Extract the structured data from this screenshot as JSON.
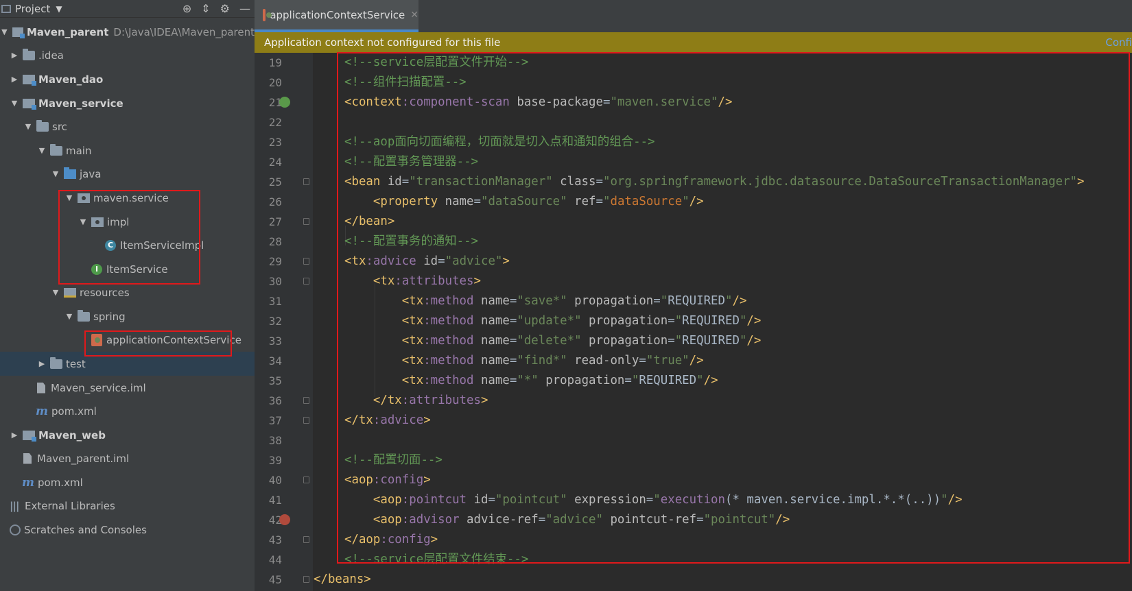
{
  "project_panel": {
    "title": "Project",
    "tree": [
      {
        "label": "Maven_parent",
        "path": "D:\\Java\\IDEA\\Maven_parent",
        "icon": "module-folder-icon",
        "bold": true
      },
      {
        "label": ".idea",
        "icon": "folder-icon"
      },
      {
        "label": "Maven_dao",
        "icon": "module-folder-icon",
        "bold": true
      },
      {
        "label": "Maven_service",
        "icon": "module-folder-icon",
        "bold": true
      },
      {
        "label": "src",
        "icon": "folder-icon"
      },
      {
        "label": "main",
        "icon": "folder-icon"
      },
      {
        "label": "java",
        "icon": "source-folder-icon"
      },
      {
        "label": "maven.service",
        "icon": "package-icon"
      },
      {
        "label": "impl",
        "icon": "package-icon"
      },
      {
        "label": "ItemServiceImpl",
        "icon": "class-icon"
      },
      {
        "label": "ItemService",
        "icon": "interface-icon"
      },
      {
        "label": "resources",
        "icon": "resources-folder-icon"
      },
      {
        "label": "spring",
        "icon": "folder-icon"
      },
      {
        "label": "applicationContextService",
        "icon": "spring-xml-icon"
      },
      {
        "label": "test",
        "icon": "folder-icon"
      },
      {
        "label": "Maven_service.iml",
        "icon": "iml-file-icon"
      },
      {
        "label": "pom.xml",
        "icon": "maven-pom-icon"
      },
      {
        "label": "Maven_web",
        "icon": "module-folder-icon",
        "bold": true
      },
      {
        "label": "Maven_parent.iml",
        "icon": "iml-file-icon"
      },
      {
        "label": "pom.xml",
        "icon": "maven-pom-icon"
      },
      {
        "label": "External Libraries",
        "icon": "library-icon"
      },
      {
        "label": "Scratches and Consoles",
        "icon": "scratches-icon"
      }
    ]
  },
  "editor": {
    "tab_label": "applicationContextService",
    "banner_message": "Application context not configured for this file",
    "banner_link": "Confi",
    "line_numbers": [
      "19",
      "20",
      "21",
      "22",
      "23",
      "24",
      "25",
      "26",
      "27",
      "28",
      "29",
      "30",
      "31",
      "32",
      "33",
      "34",
      "35",
      "36",
      "37",
      "38",
      "39",
      "40",
      "41",
      "42",
      "43",
      "44",
      "45"
    ]
  },
  "colors": {
    "highlight_box": "#e0191b",
    "banner_bg": "#8e7d16",
    "editor_bg": "#2b2b2b",
    "sidebar_bg": "#3c3f41"
  }
}
